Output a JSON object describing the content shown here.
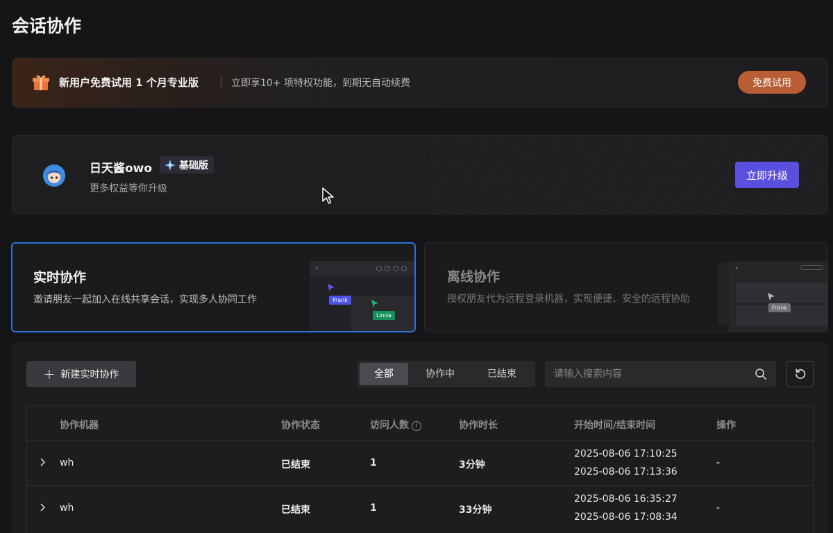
{
  "page": {
    "title": "会话协作"
  },
  "promo": {
    "title": "新用户免费试用 1 个月专业版",
    "desc": "立即享10+ 项特权功能，到期无自动续费",
    "button": "免费试用"
  },
  "user": {
    "name": "日天酱owo",
    "plan": "基础版",
    "subtitle": "更多权益等你升级",
    "upgrade_button": "立即升级"
  },
  "modes": [
    {
      "title": "实时协作",
      "desc": "邀请朋友一起加入在线共享会话，实现多人协同工作",
      "tags": [
        "Frank",
        "Linda"
      ]
    },
    {
      "title": "离线协作",
      "desc": "授权朋友代为远程登录机器，实现便捷、安全的远程协助",
      "tags": [
        "Frank"
      ]
    }
  ],
  "toolbar": {
    "new_button": "新建实时协作",
    "filters": [
      "全部",
      "协作中",
      "已结束"
    ],
    "selected_filter": "全部",
    "search_placeholder": "请输入搜索内容"
  },
  "table": {
    "columns": [
      "协作机器",
      "协作状态",
      "访问人数",
      "协作时长",
      "开始时间/结束时间",
      "操作"
    ],
    "rows": [
      {
        "machine": "wh",
        "status": "已结束",
        "visitors": "1",
        "duration": "3分钟",
        "start": "2025-08-06 17:10:25",
        "end": "2025-08-06 17:13:36",
        "action": "-"
      },
      {
        "machine": "wh",
        "status": "已结束",
        "visitors": "1",
        "duration": "33分钟",
        "start": "2025-08-06 16:35:27",
        "end": "2025-08-06 17:08:34",
        "action": "-"
      }
    ]
  },
  "colors": {
    "accent_blue": "#2b73d6",
    "upgrade_purple": "#5b4fe0",
    "trial_orange": "#b85d35"
  },
  "icons": [
    "gift-icon",
    "cursor-icon",
    "plus-icon",
    "search-icon",
    "refresh-icon",
    "chevron-right-icon",
    "info-icon",
    "plan-logo-icon"
  ]
}
